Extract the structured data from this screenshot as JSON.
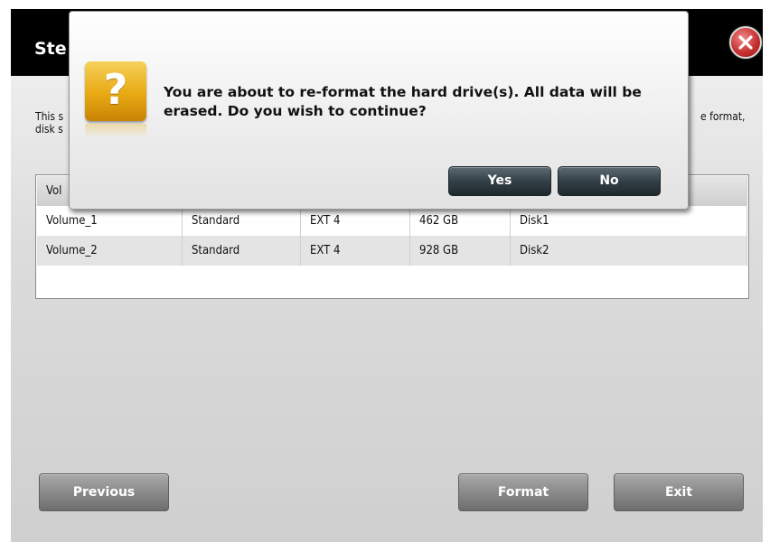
{
  "wizard": {
    "title": "Ste",
    "description_line1": "This s",
    "description_line1_right": "e format,",
    "description_line2": "disk s",
    "table": {
      "header_first": "Vol",
      "rows": [
        [
          "Volume_1",
          "Standard",
          "EXT 4",
          "462 GB",
          "Disk1"
        ],
        [
          "Volume_2",
          "Standard",
          "EXT 4",
          "928 GB",
          "Disk2"
        ]
      ]
    },
    "buttons": {
      "previous": "Previous",
      "format": "Format",
      "exit": "Exit"
    }
  },
  "dialog": {
    "icon": "question-icon",
    "icon_glyph": "?",
    "message": "You are about to re-format the hard drive(s). All data will be erased. Do you wish to continue?",
    "yes_label": "Yes",
    "no_label": "No"
  },
  "colors": {
    "header_bg": "#000000",
    "dialog_button": "#2b3940",
    "close_button": "#c93232",
    "question_icon": "#e8a913"
  }
}
